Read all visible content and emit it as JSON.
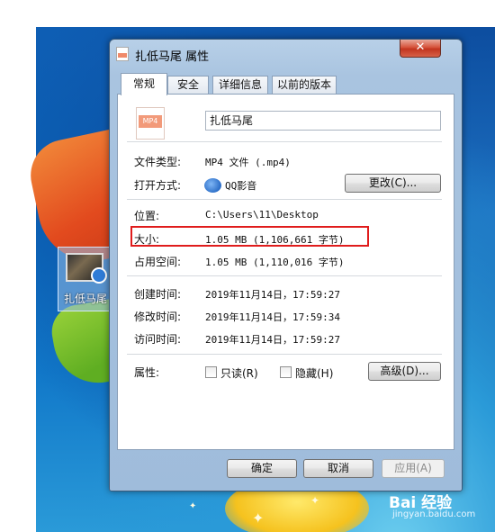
{
  "desktop": {
    "icon_label": "扎低马尾"
  },
  "window": {
    "title": "扎低马尾 属性",
    "close_glyph": "✕"
  },
  "tabs": [
    {
      "label": "常规",
      "active": true
    },
    {
      "label": "安全",
      "active": false
    },
    {
      "label": "详细信息",
      "active": false
    },
    {
      "label": "以前的版本",
      "active": false
    }
  ],
  "general": {
    "file_icon_text": "MP4",
    "file_name": "扎低马尾",
    "file_type_label": "文件类型:",
    "file_type_value": "MP4 文件 (.mp4)",
    "open_with_label": "打开方式:",
    "open_with_value": "QQ影音",
    "change_button": "更改(C)...",
    "location_label": "位置:",
    "location_value": "C:\\Users\\11\\Desktop",
    "size_label": "大小:",
    "size_value": "1.05 MB (1,106,661 字节)",
    "size_on_disk_label": "占用空间:",
    "size_on_disk_value": "1.05 MB (1,110,016 字节)",
    "created_label": "创建时间:",
    "created_value": "2019年11月14日，17:59:27",
    "modified_label": "修改时间:",
    "modified_value": "2019年11月14日，17:59:34",
    "accessed_label": "访问时间:",
    "accessed_value": "2019年11月14日，17:59:27",
    "attributes_label": "属性:",
    "readonly_label": "只读(R)",
    "readonly_checked": false,
    "hidden_label": "隐藏(H)",
    "hidden_checked": false,
    "advanced_button": "高级(D)..."
  },
  "footer": {
    "ok": "确定",
    "cancel": "取消",
    "apply": "应用(A)"
  },
  "watermark": {
    "logo": "Bai 经验",
    "url": "jingyan.baidu.com"
  },
  "colors": {
    "highlight": "#e01c1c",
    "file_icon_band": "#f29a7a"
  }
}
